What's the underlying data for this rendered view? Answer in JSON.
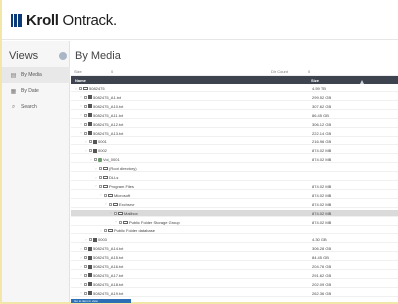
{
  "app": {
    "logo_bold": "Kroll",
    "logo_light": " Ontrack.",
    "brand_color": "#0a3a78"
  },
  "sidebar": {
    "title": "Views",
    "items": [
      {
        "icon": "media-icon",
        "label": "By Media"
      },
      {
        "icon": "calendar-icon",
        "label": "By Date"
      },
      {
        "icon": "search-icon",
        "label": "Search"
      }
    ]
  },
  "main": {
    "title": "By Media",
    "meta": {
      "size_label": "Size",
      "size_value": "0",
      "dircount_label": "Dir Count",
      "dircount_value": "0"
    },
    "columns": {
      "name": "Name",
      "size": "Size"
    },
    "rows": [
      {
        "level": 0,
        "type": "folder",
        "name": "5082475",
        "size": "4.59 TB"
      },
      {
        "level": 1,
        "type": "file",
        "name": "5082475_A1.txt",
        "size": "299.52 GB"
      },
      {
        "level": 1,
        "type": "file",
        "name": "5082475_A10.txt",
        "size": "307.62 GB"
      },
      {
        "level": 1,
        "type": "file",
        "name": "5082475_A11.txt",
        "size": "86.45 GB"
      },
      {
        "level": 1,
        "type": "file",
        "name": "5082475_A12.txt",
        "size": "306.12 GB"
      },
      {
        "level": 1,
        "type": "file",
        "name": "5082475_A13.txt",
        "size": "222.14 GB"
      },
      {
        "level": 2,
        "type": "file",
        "name": "0001",
        "size": "216.96 GB"
      },
      {
        "level": 2,
        "type": "file",
        "name": "0002",
        "size": "874.02 MB"
      },
      {
        "level": 3,
        "type": "vol",
        "name": "Vol_0001",
        "size": "874.02 MB"
      },
      {
        "level": 4,
        "type": "folder",
        "name": "(Root directory)",
        "size": ""
      },
      {
        "level": 4,
        "type": "folder",
        "name": "DLLs",
        "size": ""
      },
      {
        "level": 4,
        "type": "folder",
        "name": "Program Files",
        "size": "874.02 MB"
      },
      {
        "level": 5,
        "type": "folder",
        "name": "Microsoft",
        "size": "874.02 MB"
      },
      {
        "level": 6,
        "type": "folder",
        "name": "Exchsrvr",
        "size": "874.02 MB"
      },
      {
        "level": 7,
        "type": "folder",
        "name": "Mailbox",
        "size": "874.02 MB",
        "selected": true
      },
      {
        "level": 8,
        "type": "folder",
        "name": "Public Folder Storage Group",
        "size": "874.02 MB"
      },
      {
        "level": 5,
        "type": "folder",
        "name": "Public Folder database",
        "size": ""
      },
      {
        "level": 2,
        "type": "file",
        "name": "0003",
        "size": "4.30 GB"
      },
      {
        "level": 1,
        "type": "file",
        "name": "5082475_A14.txt",
        "size": "306.28 GB"
      },
      {
        "level": 1,
        "type": "file",
        "name": "5082475_A15.txt",
        "size": "84.45 GB"
      },
      {
        "level": 1,
        "type": "file",
        "name": "5082475_A16.txt",
        "size": "204.76 GB"
      },
      {
        "level": 1,
        "type": "file",
        "name": "5082475_A17.txt",
        "size": "291.62 GB"
      },
      {
        "level": 1,
        "type": "file",
        "name": "5082475_A18.txt",
        "size": "202.09 GB"
      },
      {
        "level": 1,
        "type": "file",
        "name": "5082475_A19.txt",
        "size": "262.36 GB"
      }
    ],
    "status_bar": "Go to item in view"
  }
}
